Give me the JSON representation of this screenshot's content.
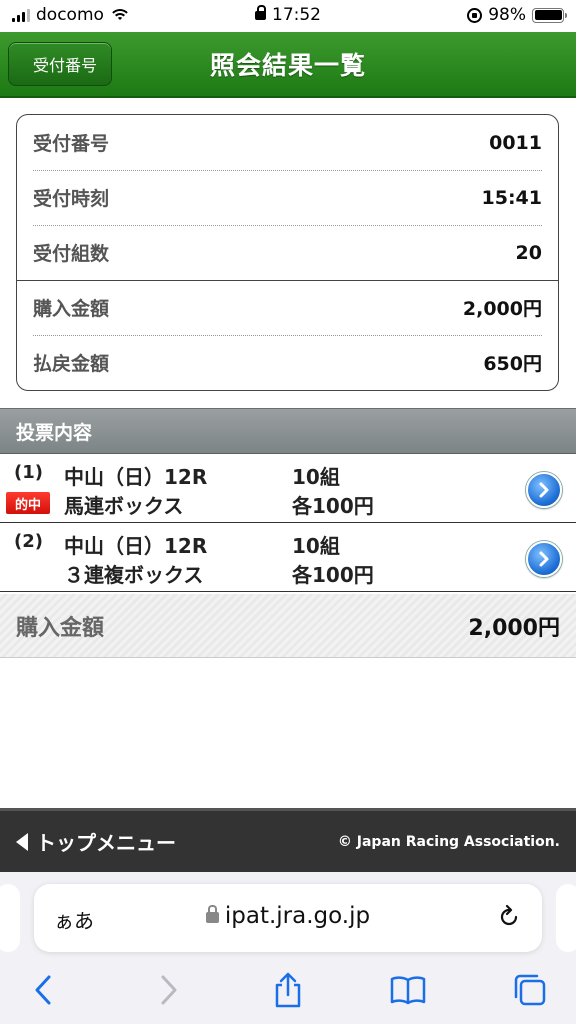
{
  "status_bar": {
    "carrier": "docomo",
    "time": "17:52",
    "battery_percent": "98%"
  },
  "header": {
    "back_label": "受付番号",
    "title": "照会結果一覧"
  },
  "summary": {
    "rows": [
      {
        "label": "受付番号",
        "value": "0011"
      },
      {
        "label": "受付時刻",
        "value": "15:41"
      },
      {
        "label": "受付組数",
        "value": "20"
      },
      {
        "label": "購入金額",
        "value": "2,000円"
      },
      {
        "label": "払戻金額",
        "value": "650円"
      }
    ]
  },
  "bets": {
    "section_title": "投票内容",
    "items": [
      {
        "num": "(1)",
        "race": "中山（日）12R",
        "kind": "馬連ボックス",
        "count": "10組",
        "amount": "各100円",
        "badge": "的中"
      },
      {
        "num": "(2)",
        "race": "中山（日）12R",
        "kind": "３連複ボックス",
        "count": "10組",
        "amount": "各100円"
      }
    ]
  },
  "total": {
    "label": "購入金額",
    "value": "2,000円"
  },
  "footer": {
    "top_menu": "トップメニュー",
    "copyright": "© Japan Racing Association."
  },
  "browser": {
    "text_size": "ぁあ",
    "url": "ipat.jra.go.jp"
  },
  "colors": {
    "header_green": "#1d7a14",
    "section_gray": "#8a9092",
    "hit_red": "#e01a10",
    "accent_blue": "#1e6fd6",
    "footer_dark": "#333333"
  }
}
